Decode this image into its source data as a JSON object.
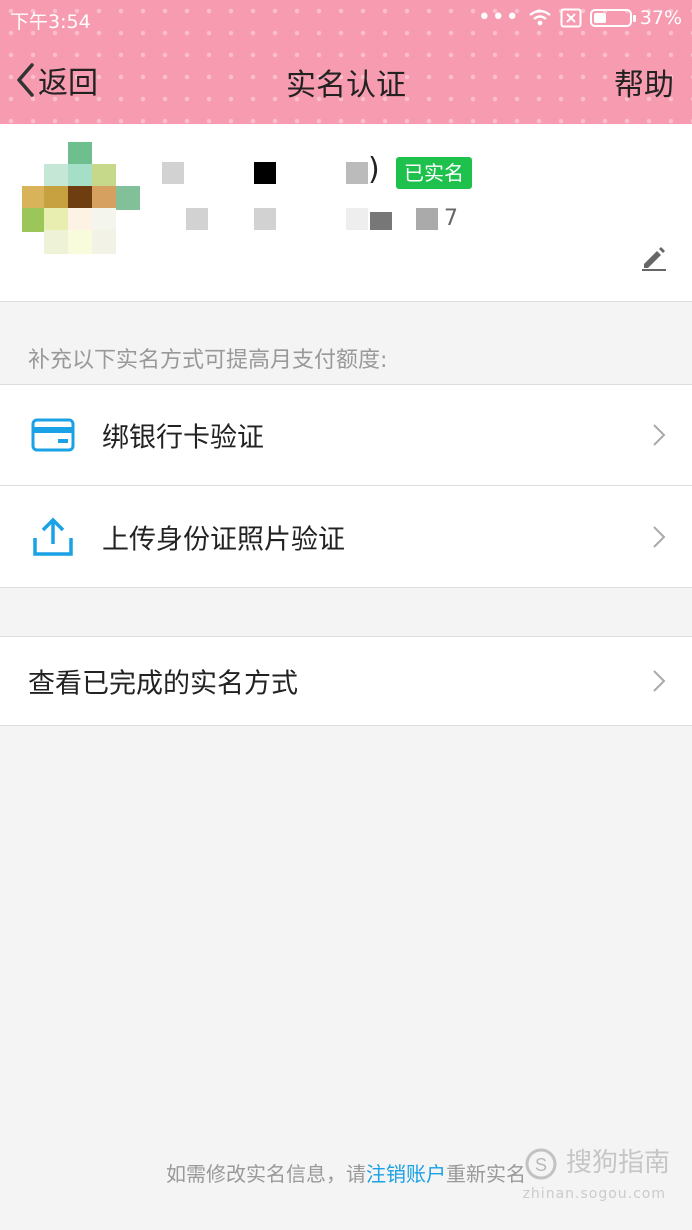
{
  "status_bar": {
    "time": "下午3:54",
    "battery": "37%",
    "battery_level": 0.37
  },
  "nav": {
    "back_label": "返回",
    "title": "实名认证",
    "help_label": "帮助"
  },
  "profile": {
    "verified_badge": "已实名",
    "name_fragment": ")",
    "id_fragment": "7"
  },
  "section_hint": "补充以下实名方式可提高月支付额度:",
  "options": [
    {
      "label": "绑银行卡验证",
      "icon": "bank-card-icon"
    },
    {
      "label": "上传身份证照片验证",
      "icon": "upload-icon"
    }
  ],
  "view_completed_label": "查看已完成的实名方式",
  "footer": {
    "prefix": "如需修改实名信息，请",
    "link": "注销账户",
    "suffix": "重新实名"
  },
  "watermark": {
    "text": "搜狗指南",
    "sub": "zhinan.sogou.com"
  },
  "colors": {
    "header": "#f79bb0",
    "badge": "#1fc14d",
    "accent": "#1aa1e6"
  }
}
